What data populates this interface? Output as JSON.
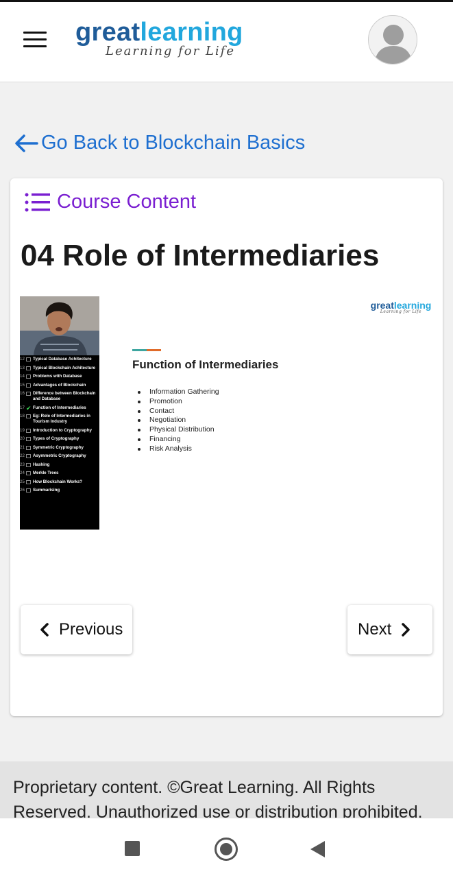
{
  "header": {
    "logo_great": "great",
    "logo_learning": "learning",
    "logo_tagline": "Learning for Life"
  },
  "back_link": "Go Back to Blockchain Basics",
  "course_content_label": "Course Content",
  "lesson_title": "04 Role of Intermediaries",
  "video": {
    "slide_logo_great": "great",
    "slide_logo_learning": "learning",
    "slide_logo_tagline": "Learning for Life",
    "slide_heading": "Function of Intermediaries",
    "slide_bullets": [
      "Information Gathering",
      "Promotion",
      "Contact",
      "Negotiation",
      "Physical Distribution",
      "Financing",
      "Risk Analysis"
    ],
    "toc": [
      {
        "num": "12",
        "label": "Typical Database Achitecture",
        "checked": false
      },
      {
        "num": "13",
        "label": "Typical Blockchain Achitecture",
        "checked": false
      },
      {
        "num": "14",
        "label": "Problems with Database",
        "checked": false
      },
      {
        "num": "15",
        "label": "Advantages of Blockchain",
        "checked": false
      },
      {
        "num": "16",
        "label": "Difference between Blockchain and Database",
        "checked": false
      },
      {
        "num": "17",
        "label": "Function of Intermediaries",
        "checked": true
      },
      {
        "num": "18",
        "label": "Eg: Role of Intermediaries in Tourism Industry",
        "checked": false
      },
      {
        "num": "19",
        "label": "Introduction to Cryptography",
        "checked": false
      },
      {
        "num": "20",
        "label": "Types of Cryptography",
        "checked": false
      },
      {
        "num": "21",
        "label": "Symmetric Cryptography",
        "checked": false
      },
      {
        "num": "22",
        "label": "Asymmetric Cryptography",
        "checked": false
      },
      {
        "num": "23",
        "label": "Hashing",
        "checked": false
      },
      {
        "num": "24",
        "label": "Merkle Trees",
        "checked": false
      },
      {
        "num": "25",
        "label": "How Blockchain Works?",
        "checked": false
      },
      {
        "num": "26",
        "label": "Summarising",
        "checked": false
      }
    ]
  },
  "buttons": {
    "previous": "Previous",
    "next": "Next"
  },
  "footer_text": "Proprietary content. ©Great Learning. All Rights Reserved. Unauthorized use or distribution prohibited.",
  "colors": {
    "link_blue": "#1e6fd0",
    "course_purple": "#7a1fd1",
    "logo_dark_blue": "#1f5c99",
    "logo_light_blue": "#22a7dd"
  }
}
